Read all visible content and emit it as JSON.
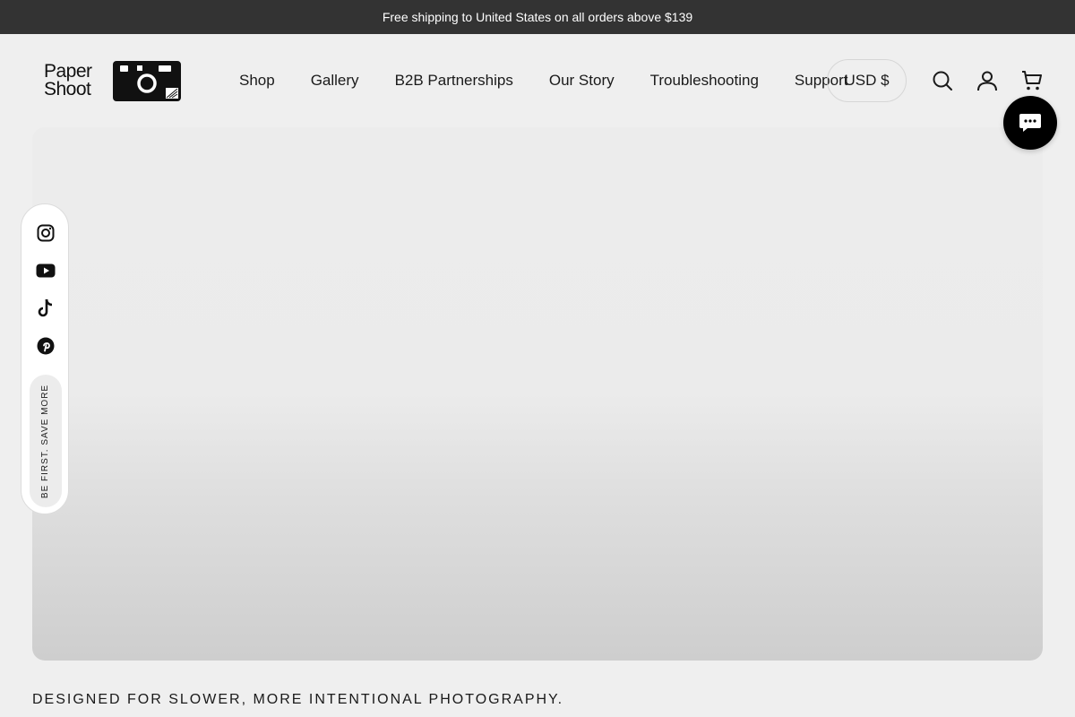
{
  "announcement": "Free shipping to United States on all orders above $139",
  "logo": {
    "line1": "Paper",
    "line2": "Shoot"
  },
  "nav": [
    {
      "label": "Shop"
    },
    {
      "label": "Gallery"
    },
    {
      "label": "B2B Partnerships"
    },
    {
      "label": "Our Story"
    },
    {
      "label": "Troubleshooting"
    },
    {
      "label": "Support"
    }
  ],
  "currency": "USD $",
  "icons": {
    "search": "search-icon",
    "account": "account-icon",
    "cart": "cart-icon",
    "chat": "chat-icon"
  },
  "social": {
    "items": [
      "instagram-icon",
      "youtube-icon",
      "tiktok-icon",
      "pinterest-icon"
    ],
    "promo": "BE FIRST. SAVE MORE"
  },
  "tagline": "DESIGNED FOR SLOWER, MORE INTENTIONAL PHOTOGRAPHY.",
  "colors": {
    "announcement_bg": "#333333",
    "page_bg": "#efefef",
    "chat_bg": "#000000"
  }
}
